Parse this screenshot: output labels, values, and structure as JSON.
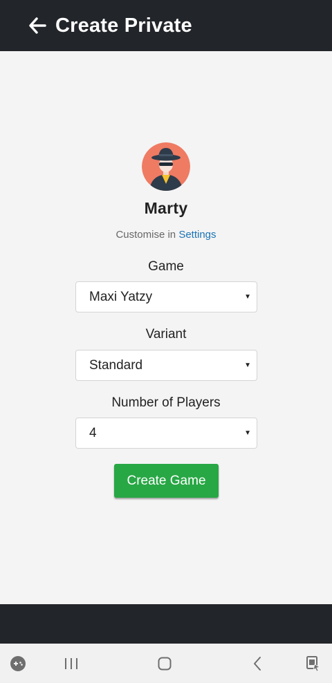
{
  "header": {
    "title": "Create Private",
    "back_icon": "arrow-left-icon"
  },
  "profile": {
    "name": "Marty",
    "avatar_icon": "spy-avatar-icon",
    "customise_prefix": "Customise in ",
    "settings_link": "Settings"
  },
  "form": {
    "game": {
      "label": "Game",
      "value": "Maxi Yatzy"
    },
    "variant": {
      "label": "Variant",
      "value": "Standard"
    },
    "players": {
      "label": "Number of Players",
      "value": "4"
    },
    "caret_icon": "caret-down-icon",
    "submit_label": "Create Game"
  },
  "system_nav": {
    "items": [
      "game-launcher-icon",
      "recent-apps-icon",
      "home-icon",
      "back-icon",
      "screen-touch-icon"
    ]
  },
  "colors": {
    "app_bar": "#222529",
    "background": "#f4f4f4",
    "accent_green": "#28a745",
    "link_blue": "#1a73b5",
    "avatar_bg": "#ef7b63"
  }
}
